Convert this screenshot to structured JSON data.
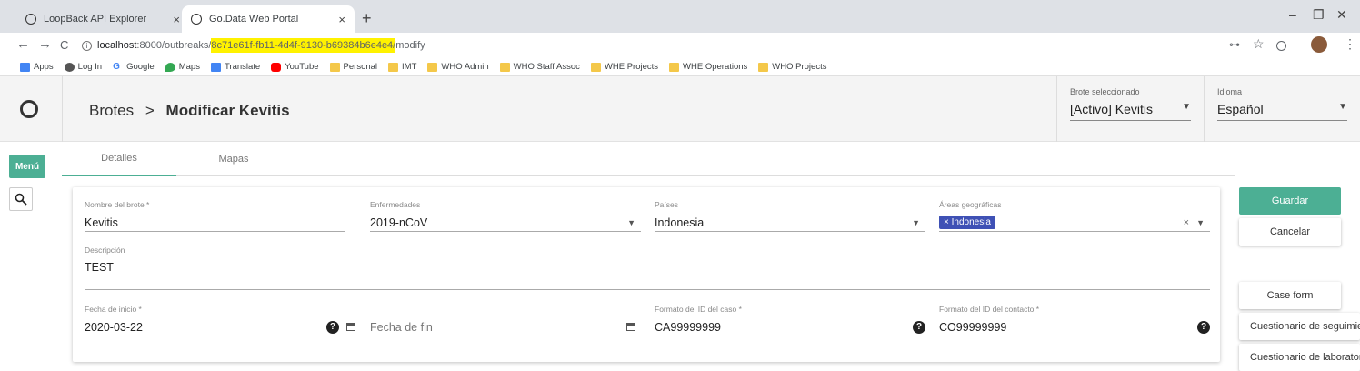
{
  "browser": {
    "tabs": [
      {
        "label": "LoopBack API Explorer",
        "close": "×"
      },
      {
        "label": "Go.Data Web Portal",
        "close": "×"
      }
    ],
    "new_tab": "+",
    "window": {
      "minimize": "–",
      "restore": "❐",
      "close": "✕"
    },
    "nav": {
      "back": "←",
      "forward": "→",
      "reload": "C"
    },
    "url": {
      "host": "localhost",
      "port_path": ":8000/outbreaks/",
      "highlight": "8c71e61f-fb11-4d4f-9130-b69384b6e4e4/",
      "rest": "modify"
    },
    "toolbar_icons": {
      "key": "⊶",
      "star": "☆",
      "menu": "⋮"
    },
    "bookmarks": [
      "Apps",
      "Log In",
      "Google",
      "Maps",
      "Translate",
      "YouTube",
      "Personal",
      "IMT",
      "WHO Admin",
      "WHO Staff Assoc",
      "WHE Projects",
      "WHE Operations",
      "WHO Projects"
    ]
  },
  "header": {
    "breadcrumb_root": "Brotes",
    "breadcrumb_sep": ">",
    "breadcrumb_current": "Modificar Kevitis",
    "outbreak_label": "Brote seleccionado",
    "outbreak_value": "[Activo] Kevitis",
    "language_label": "Idioma",
    "language_value": "Español"
  },
  "sidebar": {
    "menu_label": "Menú",
    "search_icon": "search-icon"
  },
  "tabs": [
    "Detalles",
    "Mapas"
  ],
  "form": {
    "name_label": "Nombre del brote *",
    "name_value": "Kevitis",
    "disease_label": "Enfermedades",
    "disease_value": "2019-nCoV",
    "countries_label": "Países",
    "countries_value": "Indonesia",
    "areas_label": "Áreas geográficas",
    "areas_chip": "× Indonesia",
    "areas_clear": "×",
    "description_label": "Descripción",
    "description_value": "TEST",
    "start_label": "Fecha de inicio *",
    "start_value": "2020-03-22",
    "end_placeholder": "Fecha de fin",
    "case_id_label": "Formato del ID del caso *",
    "case_id_value": "CA99999999",
    "contact_id_label": "Formato del ID del contacto *",
    "contact_id_value": "CO99999999",
    "help_glyph": "?"
  },
  "actions": {
    "save": "Guardar",
    "cancel": "Cancelar",
    "case_form": "Case form",
    "followup": "Cuestionario de seguimiento",
    "lab": "Cuestionario de laboratorio"
  },
  "colors": {
    "accent": "#4caf94",
    "chip": "#3f51b5",
    "url_highlight": "#fff200"
  }
}
